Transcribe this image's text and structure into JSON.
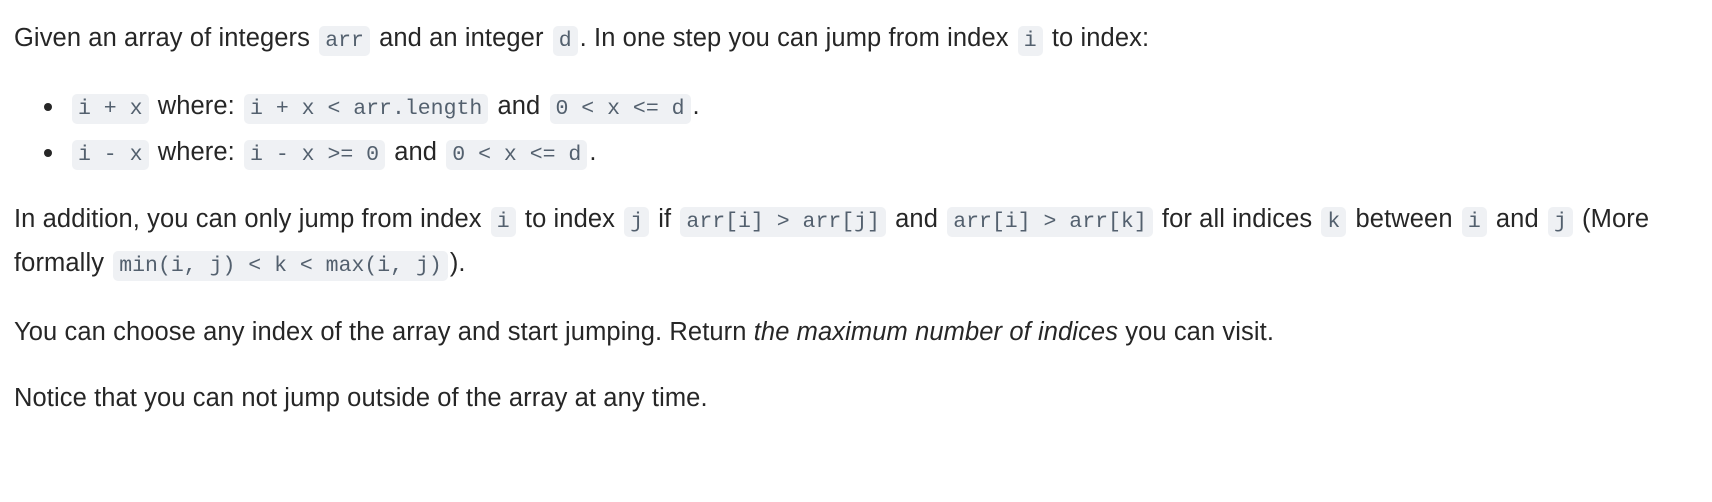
{
  "problem": {
    "intro": {
      "t1": "Given an array of integers ",
      "code_arr": "arr",
      "t2": " and an integer ",
      "code_d": "d",
      "t3": ". In one step you can jump from index ",
      "code_i": "i",
      "t4": " to index:"
    },
    "bullets": [
      {
        "code1": "i + x",
        "mid1": " where: ",
        "code2": "i + x < arr.length",
        "mid2": " and ",
        "code3": "0 < x <= d",
        "tail": "."
      },
      {
        "code1": "i - x",
        "mid1": " where: ",
        "code2": "i - x >= 0",
        "mid2": " and ",
        "code3": "0 < x <= d",
        "tail": "."
      }
    ],
    "condition": {
      "t1": "In addition, you can only jump from index ",
      "code_i": "i",
      "t2": " to index ",
      "code_j": "j",
      "t3": " if ",
      "code_cmp1": "arr[i] > arr[j]",
      "t4": " and ",
      "code_cmp2": "arr[i] > arr[k]",
      "t5": " for all indices ",
      "code_k": "k",
      "t6": " between ",
      "code_i2": "i",
      "t7": " and ",
      "code_j2": "j",
      "t8": " (More formally ",
      "code_formal": "min(i, j) < k < max(i, j)",
      "t9": ")."
    },
    "goal": {
      "t1": "You can choose any index of the array and start jumping. Return ",
      "emphasis": "the maximum number of indices",
      "t2": " you can visit."
    },
    "notice": {
      "text": "Notice that you can not jump outside of the array at any time."
    }
  },
  "colors": {
    "text": "#262626",
    "code_bg": "#eff1f4",
    "code_fg": "#53606e",
    "page_bg": "#ffffff"
  }
}
